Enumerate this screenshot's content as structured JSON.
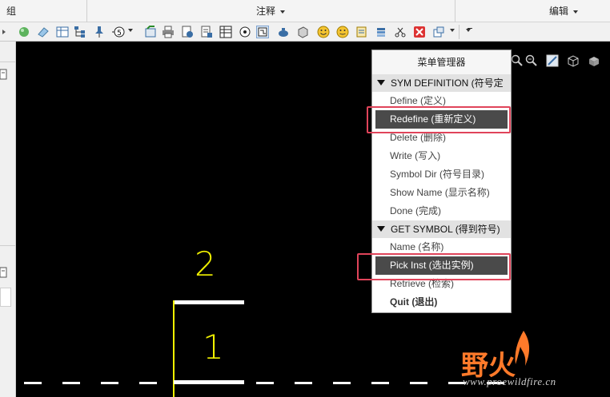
{
  "ribbon": {
    "group_left": "组",
    "group_middle": "注释",
    "group_right": "编辑"
  },
  "menu": {
    "title": "菜单管理器",
    "section1": "SYM DEFINITION (符号定",
    "items1": [
      "Define (定义)",
      "Redefine (重新定义)",
      "Delete (删除)",
      "Write (写入)",
      "Symbol Dir (符号目录)",
      "Show Name (显示名称)",
      "Done (完成)"
    ],
    "section2": "GET SYMBOL (得到符号)",
    "items2": [
      "Name (名称)",
      "Pick Inst (选出实例)",
      "Retrieve (检索)",
      "Quit (退出)"
    ]
  },
  "canvas": {
    "label_top": "2",
    "label_bottom": "1"
  },
  "watermark": {
    "text": "野火",
    "url": "www.proewildfire.cn"
  },
  "colors": {
    "highlight": "#e0445a",
    "yellow": "#f0f000",
    "watermark": "#ff7a2a"
  }
}
